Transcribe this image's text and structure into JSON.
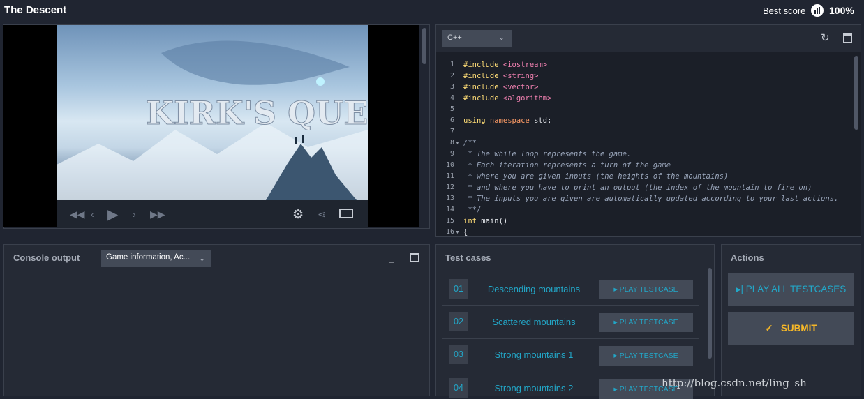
{
  "app": {
    "title": "The Descent",
    "best_score_label": "Best score",
    "best_score_value": "100%"
  },
  "viewer": {
    "game_title": "KIRK'S QUEST"
  },
  "editor": {
    "language": "C++",
    "line_numbers": [
      "1",
      "2",
      "3",
      "4",
      "5",
      "6",
      "7",
      "8",
      "9",
      "10",
      "11",
      "12",
      "13",
      "14",
      "15",
      "16"
    ],
    "code": {
      "l1_a": "#include",
      "l1_b": " <iostream>",
      "l2_a": "#include",
      "l2_b": " <string>",
      "l3_a": "#include",
      "l3_b": " <vector>",
      "l4_a": "#include",
      "l4_b": " <algorithm>",
      "l6_a": "using",
      "l6_b": " namespace",
      "l6_c": " std;",
      "l8": "/**",
      "l9": " * The while loop represents the game.",
      "l10": " * Each iteration represents a turn of the game",
      "l11": " * where you are given inputs (the heights of the mountains)",
      "l12": " * and where you have to print an output (the index of the mountain to fire on)",
      "l13": " * The inputs you are given are automatically updated according to your last actions.",
      "l14": " **/",
      "l15_a": "int",
      "l15_b": " main()",
      "l16": "{"
    }
  },
  "console": {
    "title": "Console output",
    "selector": "Game information, Ac..."
  },
  "tests": {
    "title": "Test cases",
    "items": [
      {
        "num": "01",
        "name": "Descending mountains",
        "button": "PLAY TESTCASE"
      },
      {
        "num": "02",
        "name": "Scattered mountains",
        "button": "PLAY TESTCASE"
      },
      {
        "num": "03",
        "name": "Strong mountains 1",
        "button": "PLAY TESTCASE"
      },
      {
        "num": "04",
        "name": "Strong mountains 2",
        "button": "PLAY TESTCASE"
      }
    ]
  },
  "actions": {
    "title": "Actions",
    "play_all": "PLAY ALL TESTCASES",
    "submit": "SUBMIT"
  },
  "watermark": "http://blog.csdn.net/ling_sh",
  "colors": {
    "accent": "#22a7c8",
    "submit": "#f5b728",
    "panel": "#252a35",
    "background": "#202531"
  }
}
